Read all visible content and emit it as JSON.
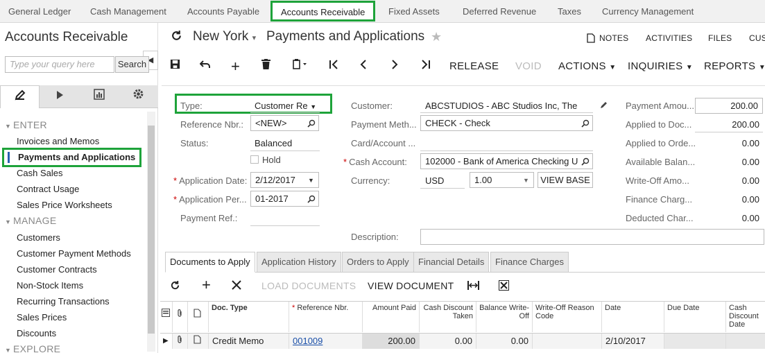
{
  "top_nav": [
    "General Ledger",
    "Cash Management",
    "Accounts Payable",
    "Accounts Receivable",
    "Fixed Assets",
    "Deferred Revenue",
    "Taxes",
    "Currency Management"
  ],
  "sidebar": {
    "title": "Accounts Receivable",
    "search_placeholder": "Type your query here",
    "search_button": "Search",
    "sections": {
      "enter": "ENTER",
      "manage": "MANAGE",
      "explore": "EXPLORE"
    },
    "enter_items": [
      "Invoices and Memos",
      "Payments and Applications",
      "Cash Sales",
      "Contract Usage",
      "Sales Price Worksheets"
    ],
    "manage_items": [
      "Customers",
      "Customer Payment Methods",
      "Customer Contracts",
      "Non-Stock Items",
      "Recurring Transactions",
      "Sales Prices",
      "Discounts"
    ]
  },
  "header": {
    "branch": "New York",
    "title": "Payments and Applications",
    "notes": "NOTES",
    "activities": "ACTIVITIES",
    "files": "FILES",
    "cus": "CUS"
  },
  "toolbar": {
    "release": "RELEASE",
    "void": "VOID",
    "actions": "ACTIONS",
    "inquiries": "INQUIRIES",
    "reports": "REPORTS"
  },
  "form": {
    "type_label": "Type:",
    "type_value": "Customer Re",
    "ref_label": "Reference Nbr.:",
    "ref_value": "<NEW>",
    "status_label": "Status:",
    "status_value": "Balanced",
    "hold_label": "Hold",
    "app_date_label": "Application Date:",
    "app_date_value": "2/12/2017",
    "app_period_label": "Application Per...",
    "app_period_value": "01-2017",
    "payment_ref_label": "Payment Ref.:",
    "customer_label": "Customer:",
    "customer_value": "ABCSTUDIOS - ABC Studios Inc, The",
    "payment_method_label": "Payment Meth...",
    "payment_method_value": "CHECK - Check",
    "card_account_label": "Card/Account ...",
    "cash_account_label": "Cash Account:",
    "cash_account_value": "102000 - Bank of America Checking U",
    "currency_label": "Currency:",
    "currency_value": "USD",
    "rate_value": "1.00",
    "view_base": "VIEW BASE",
    "description_label": "Description:",
    "payment_amount_label": "Payment Amou...",
    "payment_amount_value": "200.00",
    "applied_doc_label": "Applied to Doc...",
    "applied_doc_value": "200.00",
    "applied_order_label": "Applied to Orde...",
    "applied_order_value": "0.00",
    "available_label": "Available Balan...",
    "available_value": "0.00",
    "writeoff_label": "Write-Off Amo...",
    "writeoff_value": "0.00",
    "finance_label": "Finance Charg...",
    "finance_value": "0.00",
    "deducted_label": "Deducted Char...",
    "deducted_value": "0.00"
  },
  "tabs": [
    "Documents to Apply",
    "Application History",
    "Orders to Apply",
    "Financial Details",
    "Finance Charges"
  ],
  "grid_toolbar": {
    "load_documents": "LOAD DOCUMENTS",
    "view_document": "VIEW DOCUMENT"
  },
  "grid": {
    "headers": {
      "doc_type": "Doc. Type",
      "reference_nbr": "Reference Nbr.",
      "amount_paid": "Amount Paid",
      "cash_discount_taken": "Cash Discount Taken",
      "balance_writeoff": "Balance Write-Off",
      "writeoff_reason": "Write-Off Reason Code",
      "date": "Date",
      "due_date": "Due Date",
      "cash_discount_date": "Cash Discount Date"
    },
    "rows": [
      {
        "doc_type": "Credit Memo",
        "reference_nbr": "001009",
        "amount_paid": "200.00",
        "cash_discount_taken": "0.00",
        "balance_writeoff": "0.00",
        "writeoff_reason": "",
        "date": "2/10/2017",
        "due_date": "",
        "cash_discount_date": ""
      }
    ]
  },
  "colors": {
    "highlight": "#1ea33a",
    "link": "#1a4fa8"
  }
}
